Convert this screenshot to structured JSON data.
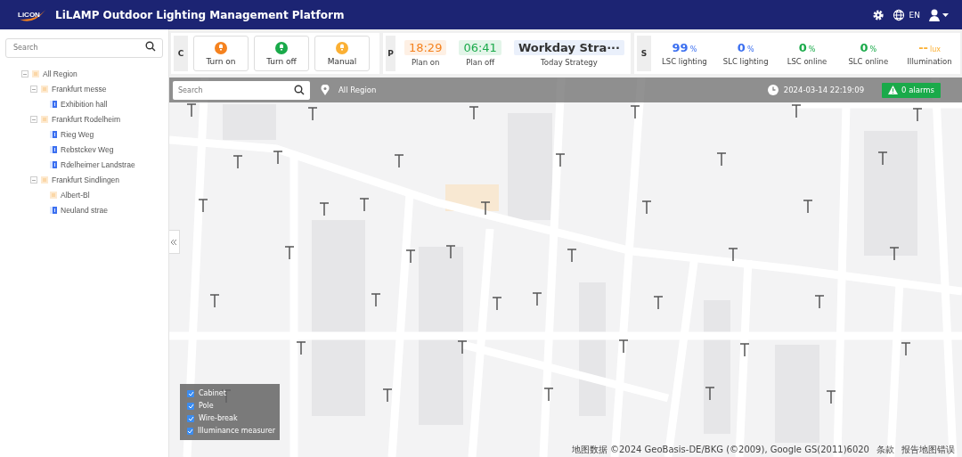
{
  "header": {
    "logo": "LiCON",
    "title": "LiLAMP Outdoor Lighting Management Platform",
    "language": "EN"
  },
  "sidebar": {
    "search": {
      "placeholder": "Search"
    },
    "tree": [
      {
        "label": "All Region",
        "kind": "region",
        "expanded": true,
        "children": [
          {
            "label": "Frankfurt messe",
            "kind": "region",
            "expanded": true,
            "children": [
              {
                "label": "Exhibition hall",
                "kind": "site"
              }
            ]
          },
          {
            "label": "Frankfurt Rodelheim",
            "kind": "region",
            "expanded": true,
            "children": [
              {
                "label": "Rieg Weg",
                "kind": "site"
              },
              {
                "label": "Rebstckev Weg",
                "kind": "site"
              },
              {
                "label": "Rdelheimer Landstrae",
                "kind": "site"
              }
            ]
          },
          {
            "label": "Frankfurt Sindlingen",
            "kind": "region",
            "expanded": true,
            "children": [
              {
                "label": "Albert-Bl",
                "kind": "region"
              },
              {
                "label": "Neuland strae",
                "kind": "site"
              }
            ]
          }
        ]
      }
    ]
  },
  "control": {
    "tag": "C",
    "buttons": [
      {
        "label": "Turn on",
        "color": "#f5821f"
      },
      {
        "label": "Turn off",
        "color": "#1aaa4a"
      },
      {
        "label": "Manual",
        "color": "#fbb034"
      }
    ]
  },
  "plan": {
    "tag": "P",
    "items": [
      {
        "time": "18:29",
        "label": "Plan on",
        "color": "#f5821f"
      },
      {
        "time": "06:41",
        "label": "Plan off",
        "color": "#1aaa4a"
      }
    ],
    "strategy": {
      "value": "Workday Stra···",
      "label": "Today Strategy"
    }
  },
  "stats": {
    "tag": "S",
    "items": [
      {
        "value": "99",
        "unit": "%",
        "label": "LSC lighting",
        "color": "#3b6ff0"
      },
      {
        "value": "0",
        "unit": "%",
        "label": "SLC lighting",
        "color": "#3b6ff0"
      },
      {
        "value": "0",
        "unit": "%",
        "label": "LSC online",
        "color": "#1aaa4a"
      },
      {
        "value": "0",
        "unit": "%",
        "label": "SLC online",
        "color": "#1aaa4a"
      },
      {
        "value": "--",
        "unit": "lux",
        "label": "Illumination",
        "color": "#fbb034"
      }
    ]
  },
  "map": {
    "search": {
      "placeholder": "Search"
    },
    "region": "All Region",
    "datetime": "2024-03-14 22:19:09",
    "alarms": "0 alarms",
    "layers": [
      {
        "label": "Cabinet",
        "checked": true
      },
      {
        "label": "Pole",
        "checked": true
      },
      {
        "label": "Wire-break",
        "checked": true
      },
      {
        "label": "Illuminance measurer",
        "checked": true
      }
    ],
    "attribution": "地图数据 ©2024 GeoBasis-DE/BKG (©2009), Google GS(2011)6020",
    "links": [
      "条款",
      "报告地图错误"
    ]
  }
}
